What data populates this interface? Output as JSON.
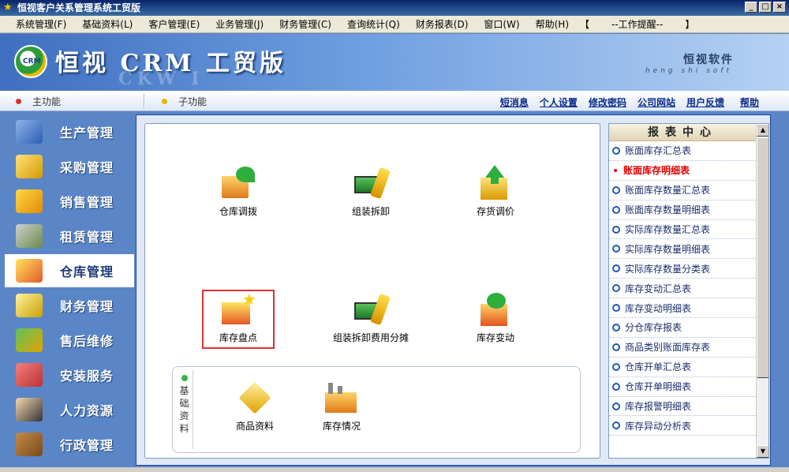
{
  "window": {
    "title": "恒视客户关系管理系统工贸版",
    "min": "_",
    "max": "□",
    "close": "×"
  },
  "menu": [
    {
      "label": "系统管理(F)"
    },
    {
      "label": "基础资料(L)"
    },
    {
      "label": "客户管理(E)"
    },
    {
      "label": "业务管理(J)"
    },
    {
      "label": "财务管理(C)"
    },
    {
      "label": "查询统计(Q)"
    },
    {
      "label": "财务报表(D)"
    },
    {
      "label": "窗口(W)"
    },
    {
      "label": "帮助(H)"
    }
  ],
  "reminder": {
    "open": "【",
    "label": "--工作提醒--",
    "close": "】"
  },
  "banner": {
    "logo": "CRM",
    "brand": "恒视 CRM 工贸版",
    "brand_shadow": "CKW I",
    "company": "恒视软件",
    "company_pinyin": "heng shi soft"
  },
  "nav": {
    "main": "主功能",
    "sub": "子功能",
    "links": [
      "短消息",
      "个人设置",
      "修改密码",
      "公司网站",
      "用户反馈"
    ],
    "help": "帮助"
  },
  "sidebar": [
    {
      "label": "生产管理"
    },
    {
      "label": "采购管理"
    },
    {
      "label": "销售管理"
    },
    {
      "label": "租赁管理"
    },
    {
      "label": "仓库管理",
      "active": true
    },
    {
      "label": "财务管理"
    },
    {
      "label": "售后维修"
    },
    {
      "label": "安装服务"
    },
    {
      "label": "人力资源"
    },
    {
      "label": "行政管理"
    }
  ],
  "modules": [
    {
      "label": "仓库调拨"
    },
    {
      "label": "组装拆卸"
    },
    {
      "label": "存货调价"
    },
    {
      "label": "库存盘点"
    },
    {
      "label": "组装拆卸费用分摊"
    },
    {
      "label": "库存变动"
    }
  ],
  "basic": {
    "tab_chars": [
      "基",
      "础",
      "资",
      "料"
    ],
    "items": [
      {
        "label": "商品资料"
      },
      {
        "label": "库存情况"
      }
    ]
  },
  "reports": {
    "header": "报表中心",
    "items": [
      {
        "label": "账面库存汇总表"
      },
      {
        "label": "账面库存明细表",
        "current": true
      },
      {
        "label": "账面库存数量汇总表"
      },
      {
        "label": "账面库存数量明细表"
      },
      {
        "label": "实际库存数量汇总表"
      },
      {
        "label": "实际库存数量明细表"
      },
      {
        "label": "实际库存数量分类表"
      },
      {
        "label": "库存变动汇总表"
      },
      {
        "label": "库存变动明细表"
      },
      {
        "label": "分仓库存报表"
      },
      {
        "label": "商品类别账面库存表"
      },
      {
        "label": "仓库开单汇总表"
      },
      {
        "label": "仓库开单明细表"
      },
      {
        "label": "库存报警明细表"
      },
      {
        "label": "库存异动分析表"
      }
    ]
  },
  "scroll": {
    "up": "▲",
    "down": "▼"
  },
  "colors": {
    "accent": "#5a86c8",
    "link": "#0a2a8a",
    "highlight": "#e03030"
  }
}
